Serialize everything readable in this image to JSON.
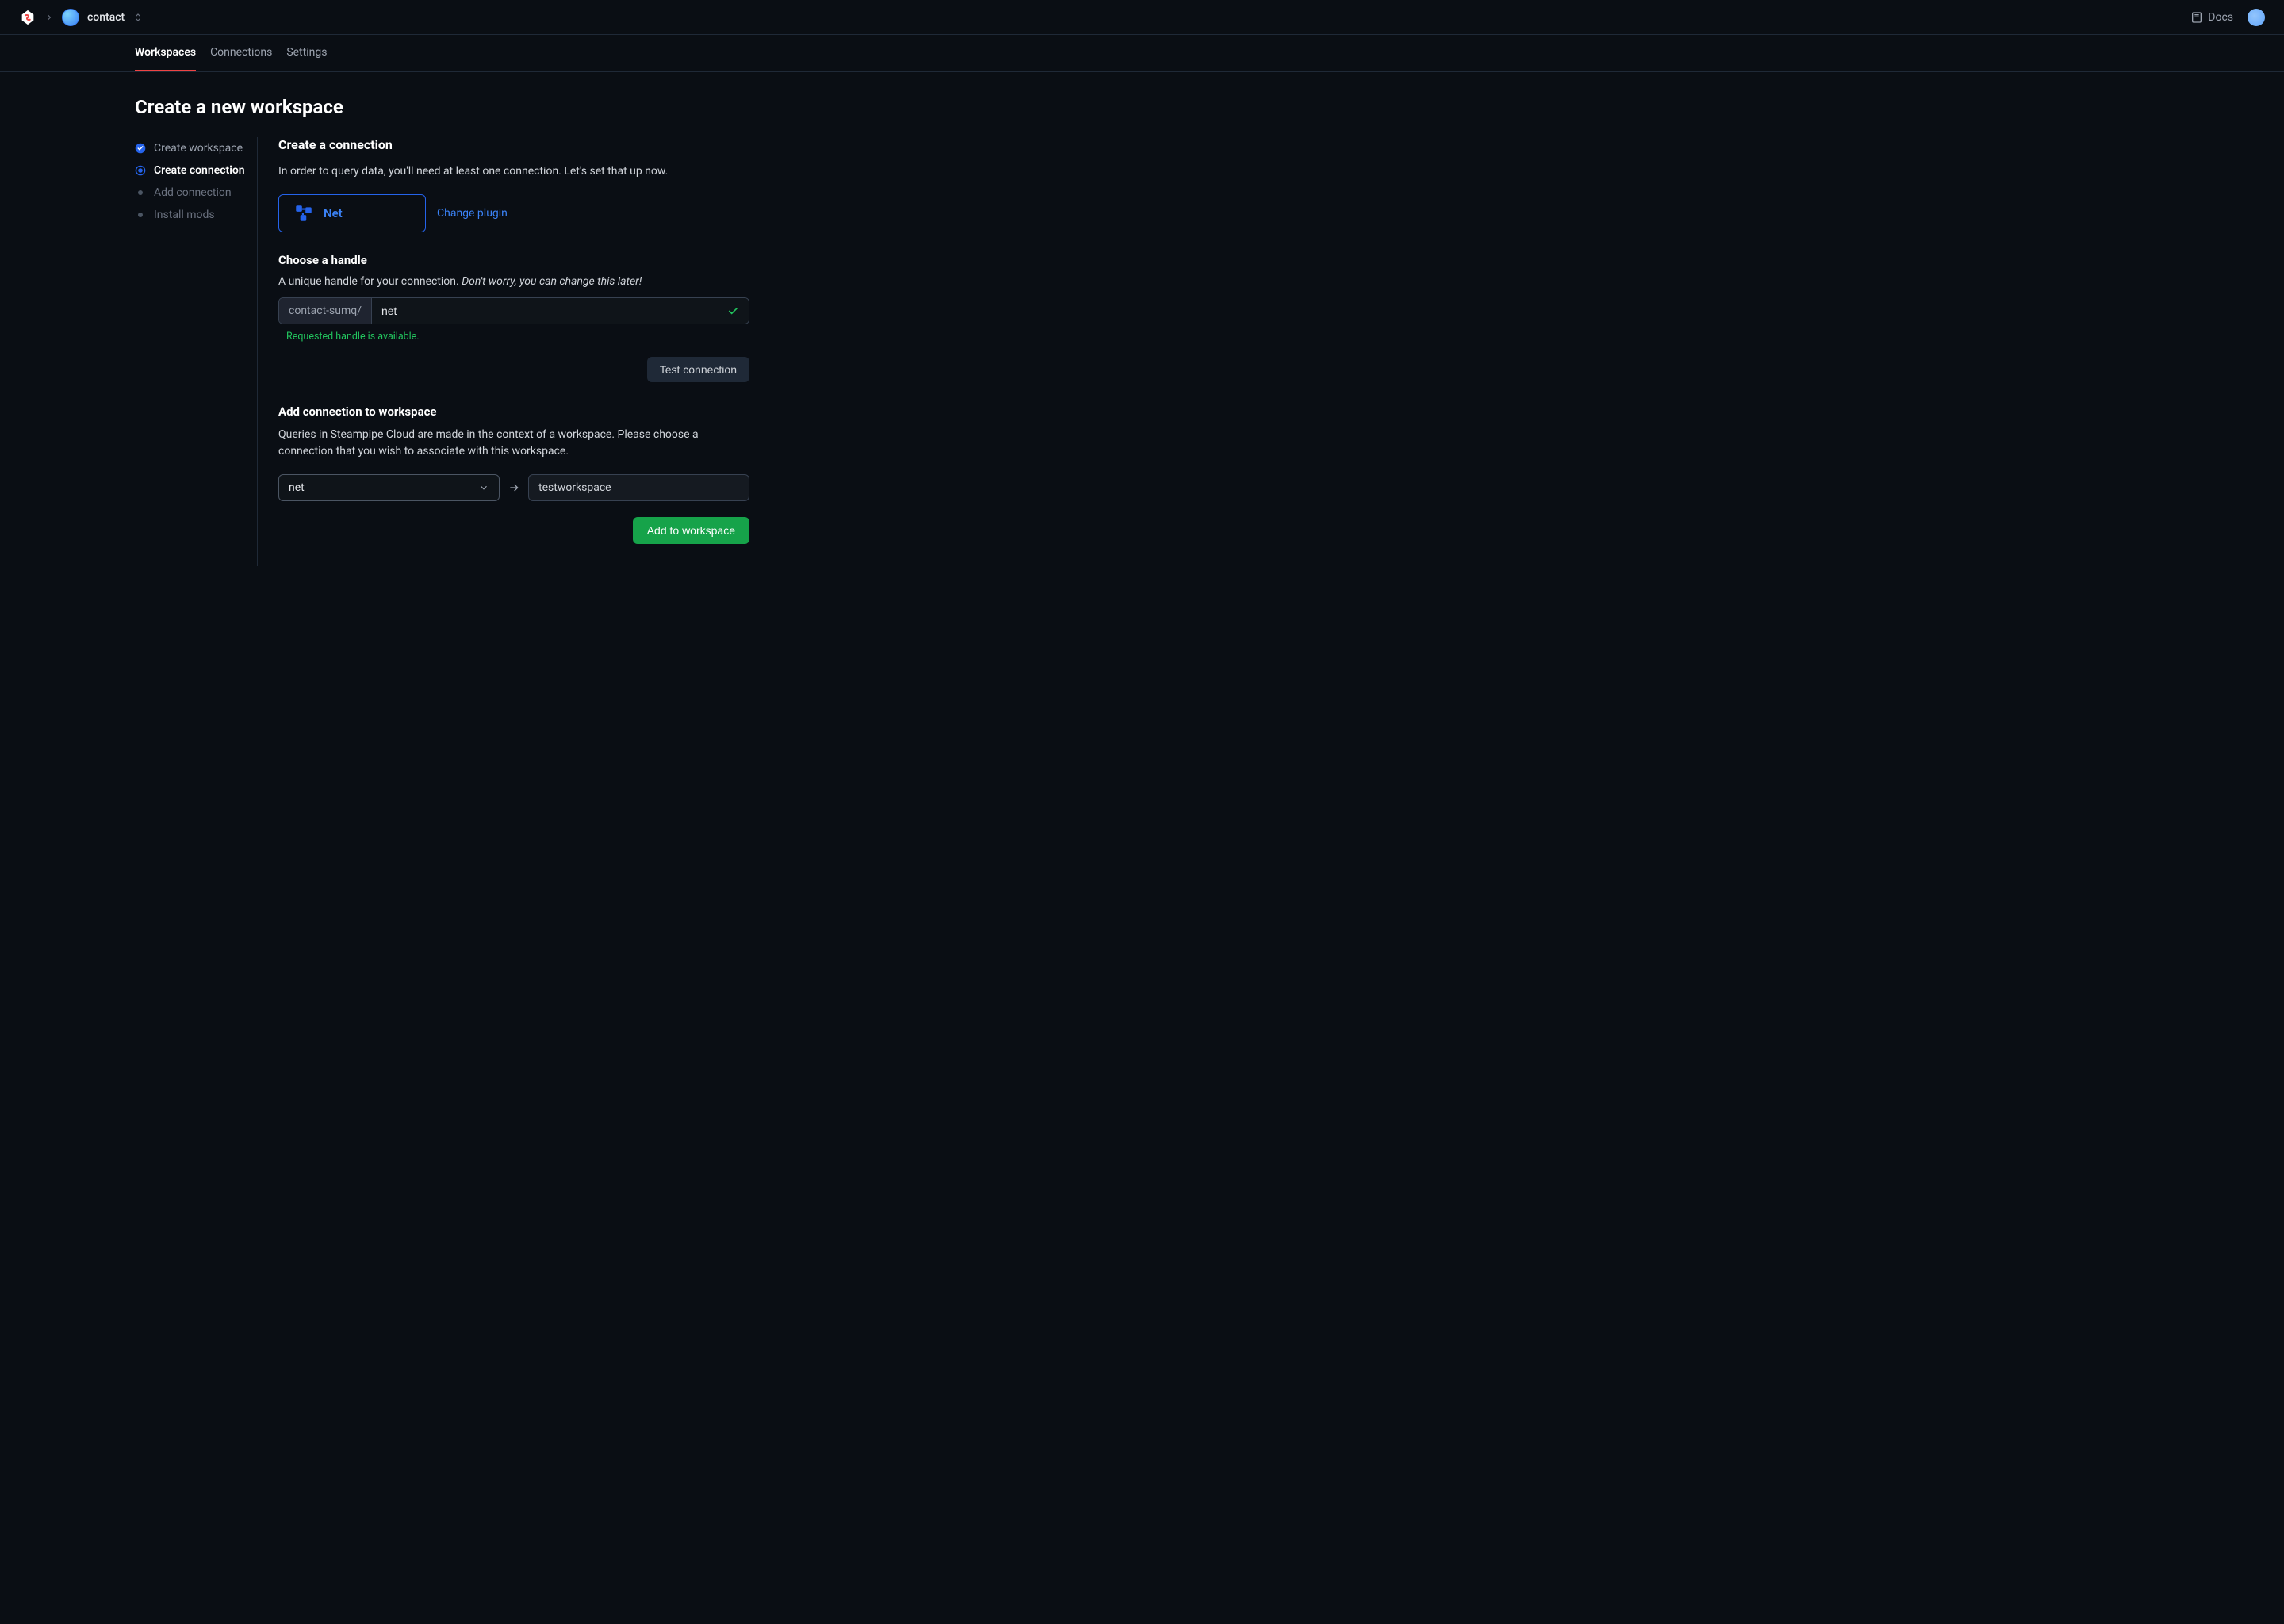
{
  "header": {
    "org_name": "contact",
    "docs_label": "Docs"
  },
  "tabs": [
    "Workspaces",
    "Connections",
    "Settings"
  ],
  "page_title": "Create a new workspace",
  "steps": [
    {
      "label": "Create workspace",
      "state": "completed"
    },
    {
      "label": "Create connection",
      "state": "active"
    },
    {
      "label": "Add connection",
      "state": "pending"
    },
    {
      "label": "Install mods",
      "state": "pending"
    }
  ],
  "create_connection": {
    "title": "Create a connection",
    "description": "In order to query data, you'll need at least one connection. Let's set that up now.",
    "plugin_name": "Net",
    "change_plugin": "Change plugin"
  },
  "handle": {
    "title": "Choose a handle",
    "description_plain": "A unique handle for your connection. ",
    "description_italic": "Don't worry, you can change this later!",
    "prefix": "contact-sumq/",
    "value": "net",
    "availability_msg": "Requested handle is available.",
    "test_button": "Test connection"
  },
  "add_connection": {
    "title": "Add connection to workspace",
    "description": "Queries in Steampipe Cloud are made in the context of a workspace. Please choose a connection that you wish to associate with this workspace.",
    "selected_connection": "net",
    "workspace_name": "testworkspace",
    "button": "Add to workspace"
  }
}
